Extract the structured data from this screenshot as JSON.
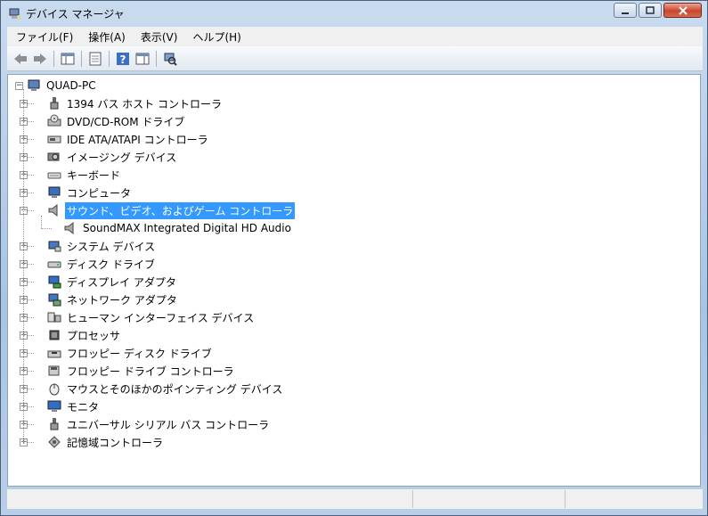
{
  "window": {
    "title": "デバイス マネージャ"
  },
  "menu": [
    "ファイル(F)",
    "操作(A)",
    "表示(V)",
    "ヘルプ(H)"
  ],
  "tree": {
    "root": "QUAD-PC",
    "categories": [
      {
        "label": "1394 バス ホスト コントローラ",
        "icon": "usb-plug-icon"
      },
      {
        "label": "DVD/CD-ROM ドライブ",
        "icon": "disc-drive-icon"
      },
      {
        "label": "IDE ATA/ATAPI コントローラ",
        "icon": "ide-controller-icon"
      },
      {
        "label": "イメージング デバイス",
        "icon": "camera-icon"
      },
      {
        "label": "キーボード",
        "icon": "keyboard-icon"
      },
      {
        "label": "コンピュータ",
        "icon": "computer-icon"
      },
      {
        "label": "サウンド、ビデオ、およびゲーム コントローラ",
        "icon": "speaker-icon",
        "selected": true,
        "expanded": true,
        "children": [
          {
            "label": "SoundMAX Integrated Digital HD Audio",
            "icon": "speaker-icon"
          }
        ]
      },
      {
        "label": "システム デバイス",
        "icon": "system-device-icon"
      },
      {
        "label": "ディスク ドライブ",
        "icon": "hard-disk-icon"
      },
      {
        "label": "ディスプレイ アダプタ",
        "icon": "display-adapter-icon"
      },
      {
        "label": "ネットワーク アダプタ",
        "icon": "network-icon"
      },
      {
        "label": "ヒューマン インターフェイス デバイス",
        "icon": "hid-icon"
      },
      {
        "label": "プロセッサ",
        "icon": "processor-icon"
      },
      {
        "label": "フロッピー ディスク ドライブ",
        "icon": "floppy-disk-icon"
      },
      {
        "label": "フロッピー ドライブ コントローラ",
        "icon": "floppy-controller-icon"
      },
      {
        "label": "マウスとそのほかのポインティング デバイス",
        "icon": "mouse-icon"
      },
      {
        "label": "モニタ",
        "icon": "monitor-icon"
      },
      {
        "label": "ユニバーサル シリアル バス コントローラ",
        "icon": "usb-plug-icon"
      },
      {
        "label": "記憶域コントローラ",
        "icon": "storage-controller-icon"
      }
    ]
  },
  "colors": {
    "selection": "#3399ff",
    "chrome": "#bcd3ea"
  }
}
